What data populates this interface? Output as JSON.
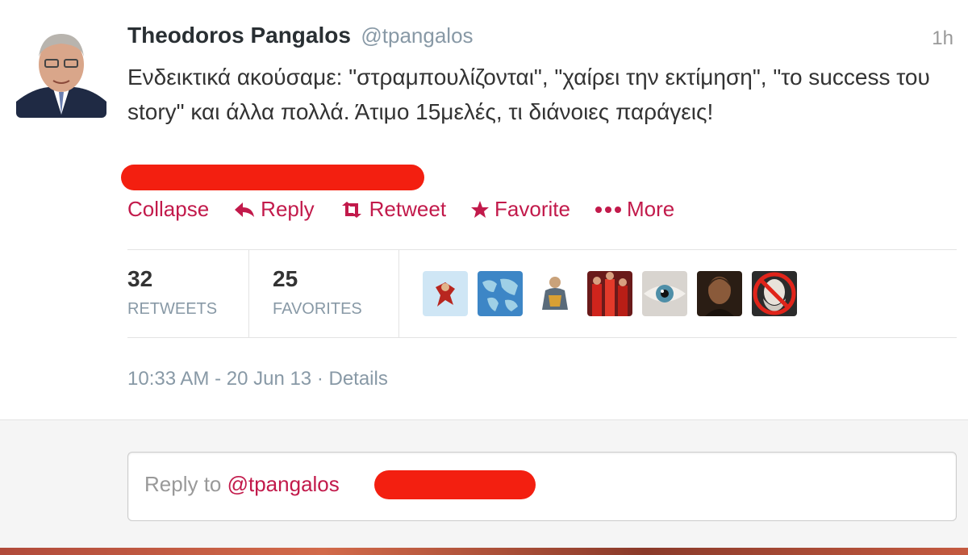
{
  "tweet": {
    "author_name": "Theodoros Pangalos",
    "screen_name": "@tpangalos",
    "time_ago": "1h",
    "text": "Ενδεικτικά ακούσαμε: \"στραμπουλίζονται\", \"χαίρει την εκτίμηση\", \"το success του story\" και άλλα πολλά. Άτιμο 15μελές, τι διάνοιες παράγεις!",
    "redacted_line": true
  },
  "actions": {
    "collapse": "Collapse",
    "reply": "Reply",
    "retweet": "Retweet",
    "favorite": "Favorite",
    "more": "More"
  },
  "stats": {
    "retweets_count": "32",
    "retweets_label": "RETWEETS",
    "favorites_count": "25",
    "favorites_label": "FAVORITES"
  },
  "favoriters": [
    {
      "icon": "cartoon-character-avatar"
    },
    {
      "icon": "world-map-avatar"
    },
    {
      "icon": "figure-avatar"
    },
    {
      "icon": "red-crowd-avatar"
    },
    {
      "icon": "eye-avatar"
    },
    {
      "icon": "portrait-avatar"
    },
    {
      "icon": "crossed-out-portrait-avatar"
    }
  ],
  "timestamp": {
    "datetime": "10:33 AM - 20 Jun 13",
    "separator": " · ",
    "details": "Details"
  },
  "reply": {
    "placeholder_prefix": "Reply to ",
    "mention": "@tpangalos"
  },
  "colors": {
    "accent": "#c21a4b",
    "redaction": "#f31f10",
    "muted": "#8899a6"
  }
}
